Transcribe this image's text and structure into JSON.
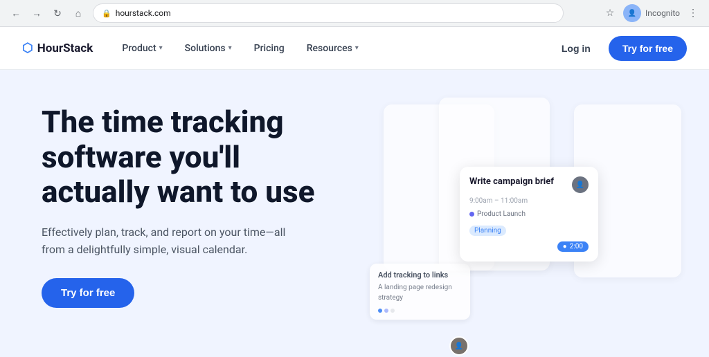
{
  "browser": {
    "url": "hourstack.com",
    "back_disabled": false,
    "forward_disabled": true,
    "incognito_label": "Incognito"
  },
  "navbar": {
    "logo_text": "HourStack",
    "nav_items": [
      {
        "label": "Product",
        "has_dropdown": true
      },
      {
        "label": "Solutions",
        "has_dropdown": true
      },
      {
        "label": "Pricing",
        "has_dropdown": false
      },
      {
        "label": "Resources",
        "has_dropdown": true
      }
    ],
    "login_label": "Log in",
    "try_label": "Try for free"
  },
  "hero": {
    "heading": "The time tracking software you'll actually want to use",
    "subtext": "Effectively plan, track, and report on your time—all from a delightfully simple, visual calendar.",
    "cta_label": "Try for free"
  },
  "event_card": {
    "title": "Write campaign brief",
    "time": "9:00am – 11:00am",
    "tag": "Product Launch",
    "label": "Planning",
    "timer": "2:00"
  },
  "small_card": {
    "title": "Add tracking to links",
    "text": "A landing page redesign strategy"
  }
}
